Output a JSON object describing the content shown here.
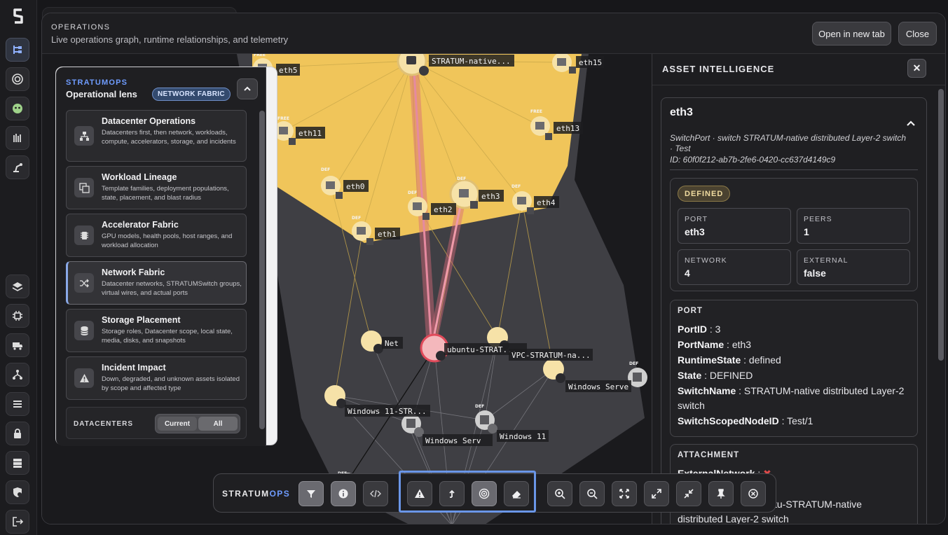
{
  "header": {
    "eyebrow": "OPERATIONS",
    "subtitle": "Live operations graph, runtime relationships, and telemetry",
    "open_tab_label": "Open in new tab",
    "close_label": "Close"
  },
  "rail": {
    "top_icons": [
      "logo-icon",
      "graph-icon",
      "target-icon",
      "alien-icon",
      "bars-icon",
      "robot-arm-icon"
    ],
    "bottom_icons": [
      "layers-icon",
      "chip-icon",
      "truck-icon",
      "network-icon",
      "list-icon",
      "lock-icon",
      "server-icon",
      "shield-lock-icon",
      "logout-icon"
    ]
  },
  "lens": {
    "brand": "STRATUMOPS",
    "title": "Operational lens",
    "active_pill": "NETWORK FABRIC",
    "items": [
      {
        "name": "Datacenter Operations",
        "desc": "Datacenters first, then network, workloads, compute, accelerators, storage, and incidents",
        "icon": "hierarchy-icon"
      },
      {
        "name": "Workload Lineage",
        "desc": "Template families, deployment populations, state, placement, and blast radius",
        "icon": "copy-icon"
      },
      {
        "name": "Accelerator Fabric",
        "desc": "GPU models, health pools, host ranges, and workload allocation",
        "icon": "chip-icon"
      },
      {
        "name": "Network Fabric",
        "desc": "Datacenter networks, STRATUMSwitch groups, virtual wires, and actual ports",
        "icon": "shuffle-icon"
      },
      {
        "name": "Storage Placement",
        "desc": "Storage roles, Datacenter scope, local state, media, disks, and snapshots",
        "icon": "database-icon"
      },
      {
        "name": "Incident Impact",
        "desc": "Down, degraded, and unknown assets isolated by scope and affected type",
        "icon": "warning-icon"
      }
    ],
    "datacenters_label": "DATACENTERS",
    "seg_current": "Current",
    "seg_all": "All"
  },
  "graph": {
    "labels": {
      "native": "STRATUM-native...",
      "eth15": "eth15",
      "eth5": "eth5",
      "eth11": "eth11",
      "eth13": "eth13",
      "eth0": "eth0",
      "eth3": "eth3",
      "eth4": "eth4",
      "eth2": "eth2",
      "eth1": "eth1",
      "net": "Net",
      "ubuntu": "ubuntu-STRAT...",
      "vpc": "VPC-STRATUM-na...",
      "winserve1": "Windows Serve",
      "win11str": "Windows 11-STR...",
      "winserve2": "Windows Serv",
      "win11": "Windows 11"
    },
    "tags": {
      "def": "DEF",
      "free": "FREE"
    }
  },
  "asset": {
    "title": "ASSET INTELLIGENCE",
    "name": "eth3",
    "meta": "SwitchPort · switch STRATUM-native distributed Layer-2 switch · Test",
    "id": "ID: 60f0f212-ab7b-2fe6-0420-cc637d4149c9",
    "badge": "DEFINED",
    "kv": [
      {
        "k": "PORT",
        "v": "eth3"
      },
      {
        "k": "PEERS",
        "v": "1"
      },
      {
        "k": "NETWORK",
        "v": "4"
      },
      {
        "k": "EXTERNAL",
        "v": "false"
      }
    ],
    "port_heading": "PORT",
    "port_props": [
      {
        "k": "PortID",
        "v": "3"
      },
      {
        "k": "PortName",
        "v": "eth3"
      },
      {
        "k": "RuntimeState",
        "v": "defined"
      },
      {
        "k": "State",
        "v": "DEFINED"
      },
      {
        "k": "SwitchName",
        "v": "STRATUM-native distributed Layer-2 switch"
      },
      {
        "k": "SwitchScopedNodeID",
        "v": "Test/1"
      }
    ],
    "attach_heading": "ATTACHMENT",
    "attach_props": [
      {
        "k": "ExternalNetwork",
        "v": "✖"
      },
      {
        "k": "",
        "v": "tu-STRATUM-native distributed Layer-2 switch"
      }
    ]
  },
  "toolbar": {
    "brand_a": "STRATUM",
    "brand_b": "OPS",
    "buttons": [
      "filter-icon",
      "info-icon",
      "code-icon",
      "warning-icon",
      "upload-icon",
      "radar-icon",
      "eraser-icon",
      "zoom-in-icon",
      "zoom-out-icon",
      "fit-icon",
      "expand-icon",
      "collapse-icon",
      "pin-icon",
      "stop-icon"
    ]
  },
  "colors": {
    "accent": "#6f9cff",
    "highlight": "#f0c55a",
    "selected_edge": "#d86a7a"
  }
}
